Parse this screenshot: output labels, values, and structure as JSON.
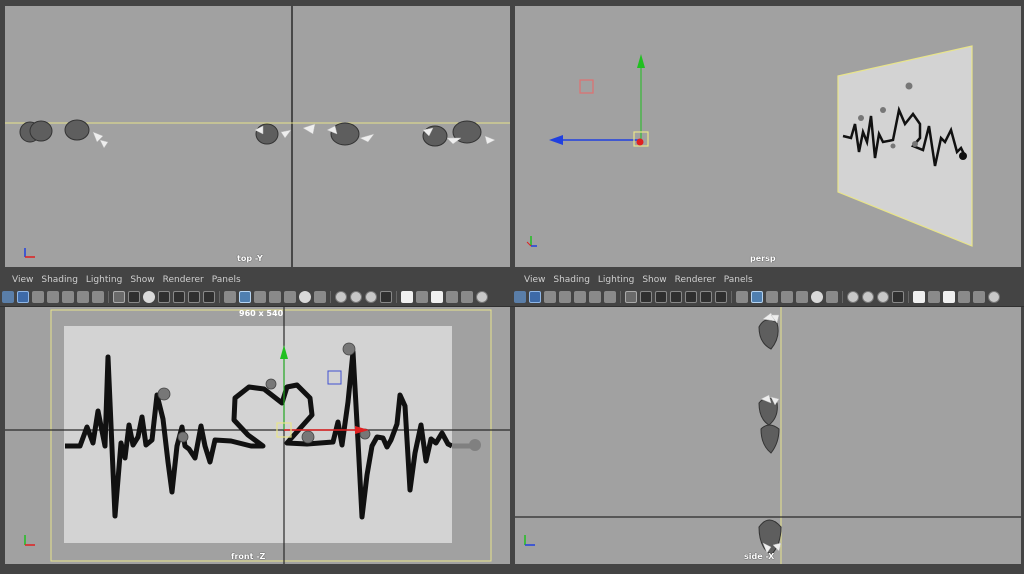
{
  "top_left": {
    "label": "top -Y"
  },
  "top_right": {
    "label": "persp"
  },
  "bottom_left": {
    "menu": [
      "View",
      "Shading",
      "Lighting",
      "Show",
      "Renderer",
      "Panels"
    ],
    "label": "front -Z",
    "resolution": "960 x 540"
  },
  "bottom_right": {
    "menu": [
      "View",
      "Shading",
      "Lighting",
      "Show",
      "Renderer",
      "Panels"
    ],
    "label": "side -X"
  },
  "colors": {
    "viewport_bg": "#a1a1a1",
    "panel_bg": "#444444",
    "gate": "#e8e48a",
    "axis_x": "#e02020",
    "axis_y": "#20c020",
    "axis_z": "#2040e0"
  },
  "icons": [
    "camera-icon",
    "camera-select-icon",
    "image-plane-icon",
    "grid-icon",
    "wireframe-icon",
    "smooth-shade-icon",
    "xray-icon",
    "isolate-icon",
    "lighting-icon",
    "shadow-icon",
    "texture-icon",
    "resolution-gate-icon",
    "film-gate-icon"
  ]
}
